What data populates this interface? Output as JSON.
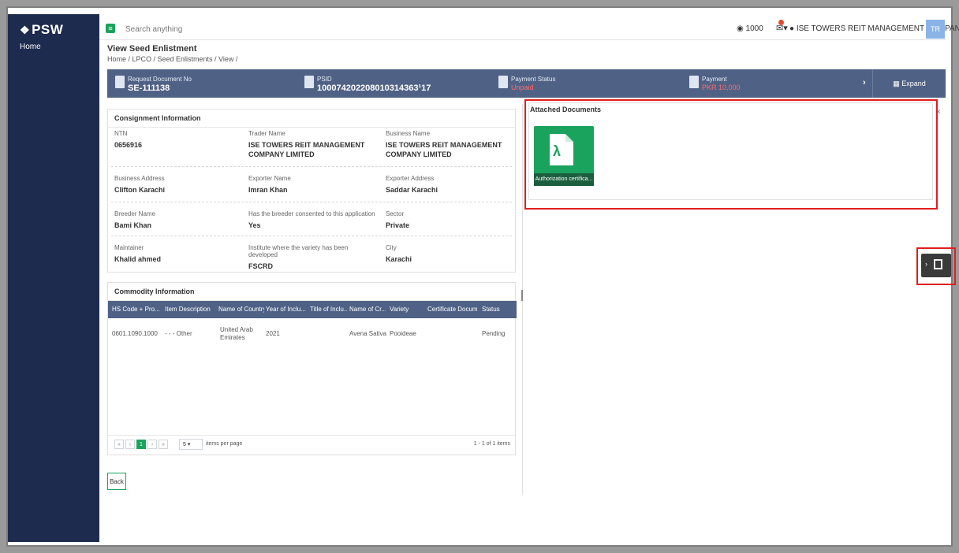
{
  "app": {
    "logo": "PSW",
    "logo_mark": "❖",
    "nav_home": "Home",
    "search_placeholder": "Search anything",
    "credits": "1000",
    "user_name": "ISE TOWERS REIT MANAGEMENT COMPANY LIMITED ▾",
    "avatar": "TR"
  },
  "page": {
    "title": "View Seed Enlistment",
    "breadcrumb": "Home / LPCO / Seed Enlistments / View /"
  },
  "summary": {
    "request_label": "Request Document No",
    "request_value": "SE-111138",
    "psid_label": "PSID",
    "psid_value": "100074202208010314363¹17",
    "payment_status_label": "Payment Status",
    "payment_status_value": "Unpaid",
    "payment_label": "Payment",
    "payment_value": "PKR 10,000",
    "expand_label": "Expand"
  },
  "consignment": {
    "heading": "Consignment Information",
    "fields": [
      {
        "label": "NTN",
        "value": "0656916"
      },
      {
        "label": "Trader Name",
        "value": "ISE TOWERS REIT MANAGEMENT COMPANY LIMITED"
      },
      {
        "label": "Business Name",
        "value": "ISE TOWERS REIT MANAGEMENT COMPANY LIMITED"
      },
      {
        "label": "Business Address",
        "value": "Clifton Karachi"
      },
      {
        "label": "Exporter Name",
        "value": "Imran Khan"
      },
      {
        "label": "Exporter Address",
        "value": "Saddar Karachi"
      },
      {
        "label": "Breeder Name",
        "value": "Bami Khan"
      },
      {
        "label": "Has the breeder consented to this application",
        "value": "Yes"
      },
      {
        "label": "Sector",
        "value": "Private"
      },
      {
        "label": "Maintainer",
        "value": "Khalid ahmed"
      },
      {
        "label": "Institute where the variety has been developed",
        "value": "FSCRD"
      },
      {
        "label": "City",
        "value": "Karachi"
      }
    ]
  },
  "commodity": {
    "heading": "Commodity Information",
    "columns": [
      "HS Code + Pro...",
      "Item Description",
      "Name of Country",
      "Year of Inclu...",
      "Title of Inclu...",
      "Name of Cr...",
      "Variety",
      "Certificate Docum...",
      "Status"
    ],
    "rows": [
      [
        "0601.1090.1000",
        "- - - Other",
        "United Arab Emirates",
        "2021",
        "",
        "Avena Sativa",
        "Pooideae",
        "",
        "Pending"
      ]
    ],
    "pager": {
      "first": "«",
      "prev": "‹",
      "current": "1",
      "next": "›",
      "last": "»",
      "page_size": "5",
      "items_per_page_label": "items per page",
      "count_label": "1 - 1 of 1 items"
    }
  },
  "actions": {
    "back_label": "Back"
  },
  "attachments": {
    "heading": "Attached Documents",
    "close": "×",
    "documents": [
      {
        "name": "Authorization certifica..."
      }
    ]
  },
  "colors": {
    "sidebar": "#1d2b4f",
    "summary_bar": "#4f6286",
    "accent_green": "#1aa35c",
    "highlight_red": "#e01e1e",
    "unpaid_red": "#ff6b6b"
  },
  "icons": [
    "hamburger-menu-icon",
    "coin-icon",
    "notification-icon",
    "user-icon",
    "document-icon",
    "pdf-icon",
    "chevron-right-icon",
    "grid-icon",
    "close-icon",
    "edit-note-icon"
  ]
}
